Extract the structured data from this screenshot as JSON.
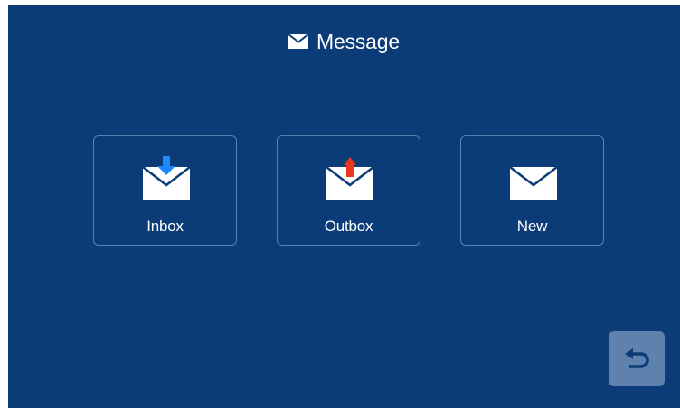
{
  "header": {
    "title": "Message",
    "icon": "envelope-icon"
  },
  "tiles": [
    {
      "label": "Inbox",
      "icon": "envelope-arrow-down-icon",
      "accent": "#1e88ff"
    },
    {
      "label": "Outbox",
      "icon": "envelope-arrow-up-icon",
      "accent": "#e8391e"
    },
    {
      "label": "New",
      "icon": "envelope-icon"
    }
  ],
  "back_button": {
    "icon": "back-arrow-icon"
  },
  "colors": {
    "background": "#0b3c78",
    "tile_border": "#5b7fae",
    "back_button_bg": "#5e81ad",
    "text": "#ffffff"
  }
}
